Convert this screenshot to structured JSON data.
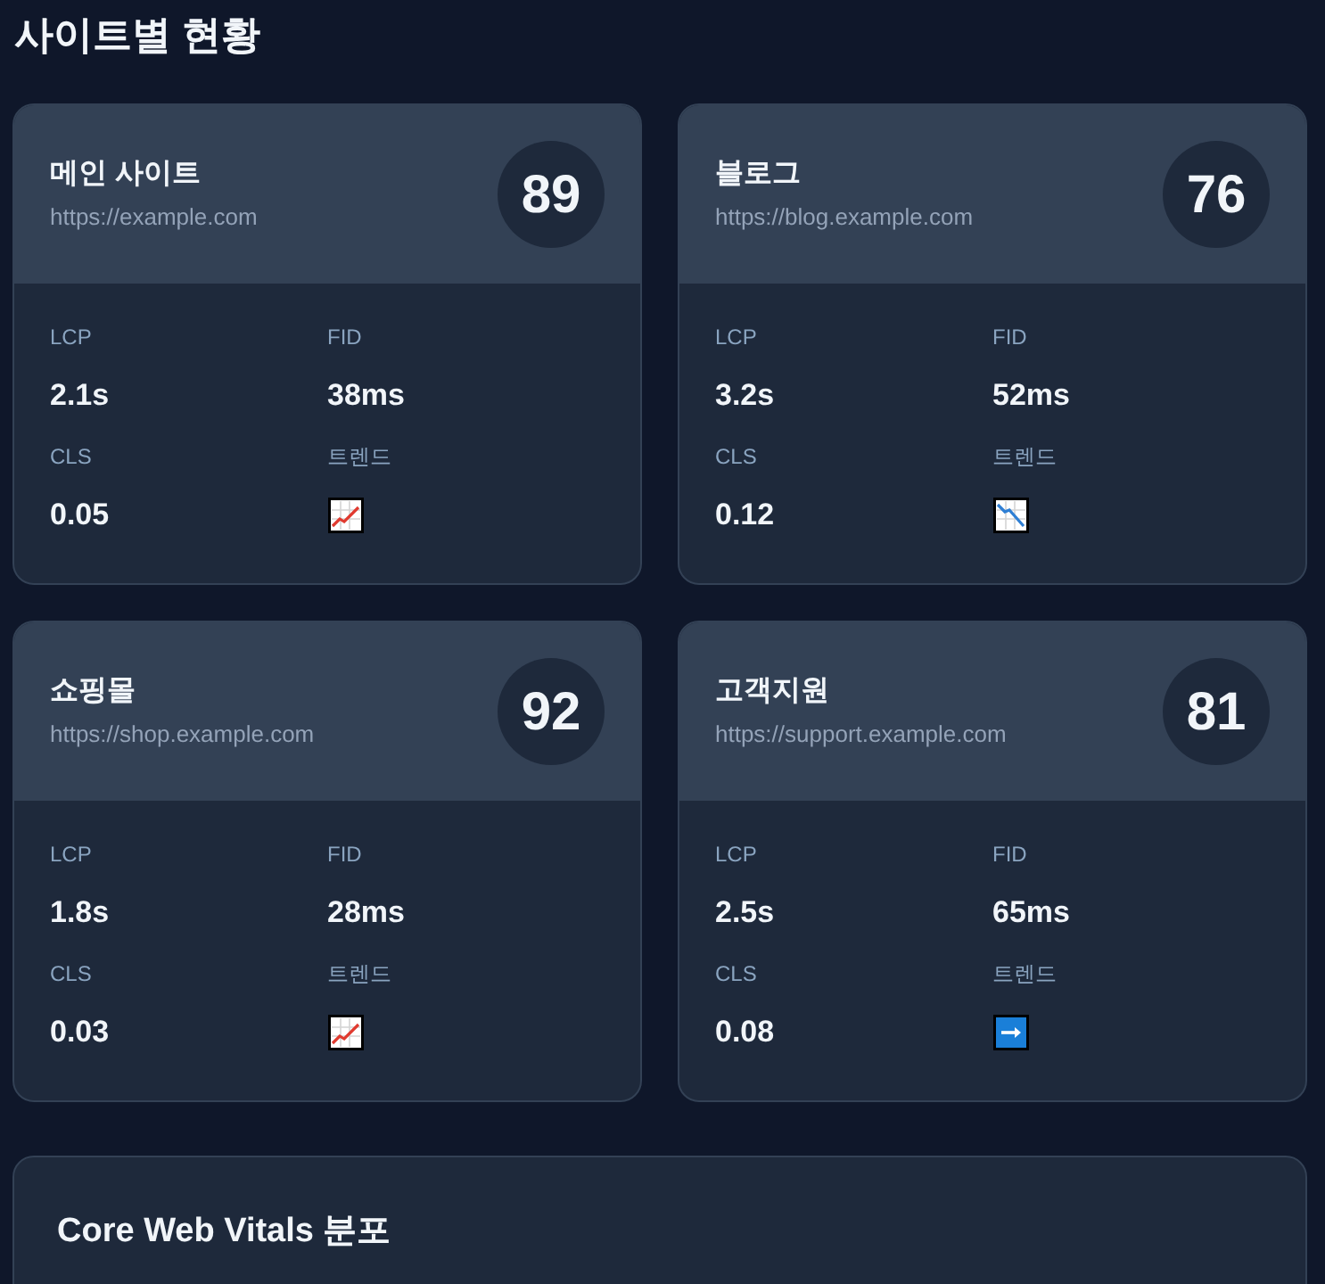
{
  "page": {
    "title": "사이트별 현황"
  },
  "sites": [
    {
      "name": "메인 사이트",
      "url": "https://example.com",
      "score": "89",
      "metrics": [
        {
          "label": "LCP",
          "value": "2.1s"
        },
        {
          "label": "FID",
          "value": "38ms"
        },
        {
          "label": "CLS",
          "value": "0.05"
        }
      ],
      "trend_label": "트렌드",
      "trend": {
        "kind": "up"
      }
    },
    {
      "name": "블로그",
      "url": "https://blog.example.com",
      "score": "76",
      "metrics": [
        {
          "label": "LCP",
          "value": "3.2s"
        },
        {
          "label": "FID",
          "value": "52ms"
        },
        {
          "label": "CLS",
          "value": "0.12"
        }
      ],
      "trend_label": "트렌드",
      "trend": {
        "kind": "down"
      }
    },
    {
      "name": "쇼핑몰",
      "url": "https://shop.example.com",
      "score": "92",
      "metrics": [
        {
          "label": "LCP",
          "value": "1.8s"
        },
        {
          "label": "FID",
          "value": "28ms"
        },
        {
          "label": "CLS",
          "value": "0.03"
        }
      ],
      "trend_label": "트렌드",
      "trend": {
        "kind": "up"
      }
    },
    {
      "name": "고객지원",
      "url": "https://support.example.com",
      "score": "81",
      "metrics": [
        {
          "label": "LCP",
          "value": "2.5s"
        },
        {
          "label": "FID",
          "value": "65ms"
        },
        {
          "label": "CLS",
          "value": "0.08"
        }
      ],
      "trend_label": "트렌드",
      "trend": {
        "kind": "flat"
      }
    }
  ],
  "distribution": {
    "title": "Core Web Vitals 분포"
  }
}
